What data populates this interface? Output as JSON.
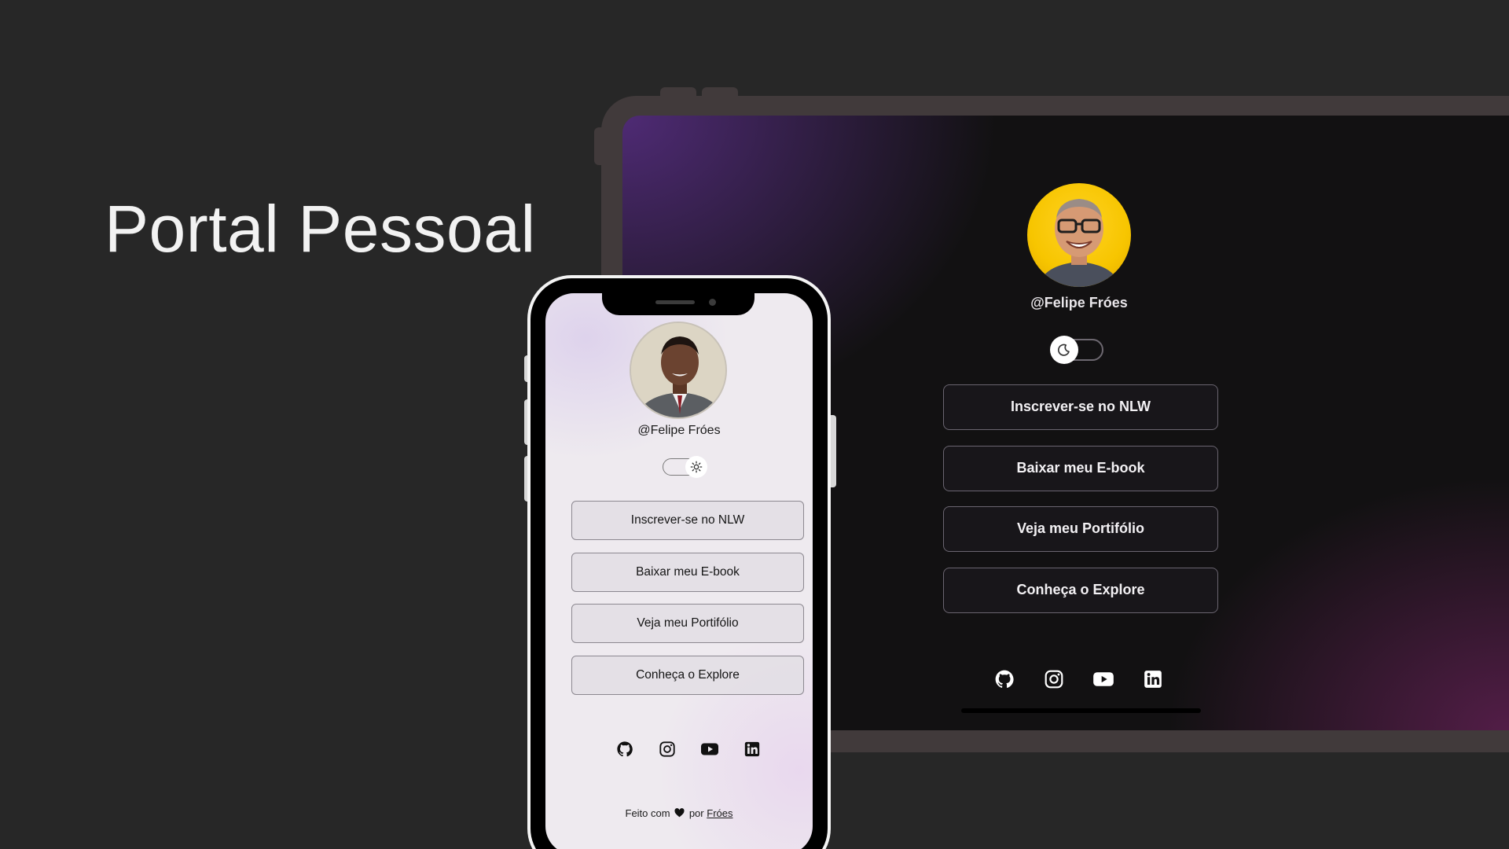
{
  "hero": {
    "title": "Portal Pessoal"
  },
  "tablet": {
    "handle": "@Felipe Fróes",
    "theme_toggle": {
      "mode": "dark",
      "icon": "moon-icon"
    },
    "links": [
      {
        "label": "Inscrever-se no NLW"
      },
      {
        "label": "Baixar meu E-book"
      },
      {
        "label": "Veja meu Portifólio"
      },
      {
        "label": "Conheça o Explore"
      }
    ],
    "social": [
      "github-icon",
      "instagram-icon",
      "youtube-icon",
      "linkedin-icon"
    ]
  },
  "phone": {
    "handle": "@Felipe Fróes",
    "theme_toggle": {
      "mode": "light",
      "icon": "sun-icon"
    },
    "links": [
      {
        "label": "Inscrever-se no NLW"
      },
      {
        "label": "Baixar meu E-book"
      },
      {
        "label": "Veja meu Portifólio"
      },
      {
        "label": "Conheça o Explore"
      }
    ],
    "social": [
      "github-icon",
      "instagram-icon",
      "youtube-icon",
      "linkedin-icon"
    ],
    "footer": {
      "prefix": "Feito com",
      "connector": "por",
      "author": "Fróes"
    }
  },
  "colors": {
    "page_bg": "#272727",
    "tablet_frame": "#413a3b",
    "tablet_accent_purple": "#522c7a",
    "tablet_accent_magenta": "#561e4a",
    "phone_screen_bg": "#eeeaef",
    "avatar_yellow": "#f7c500"
  }
}
